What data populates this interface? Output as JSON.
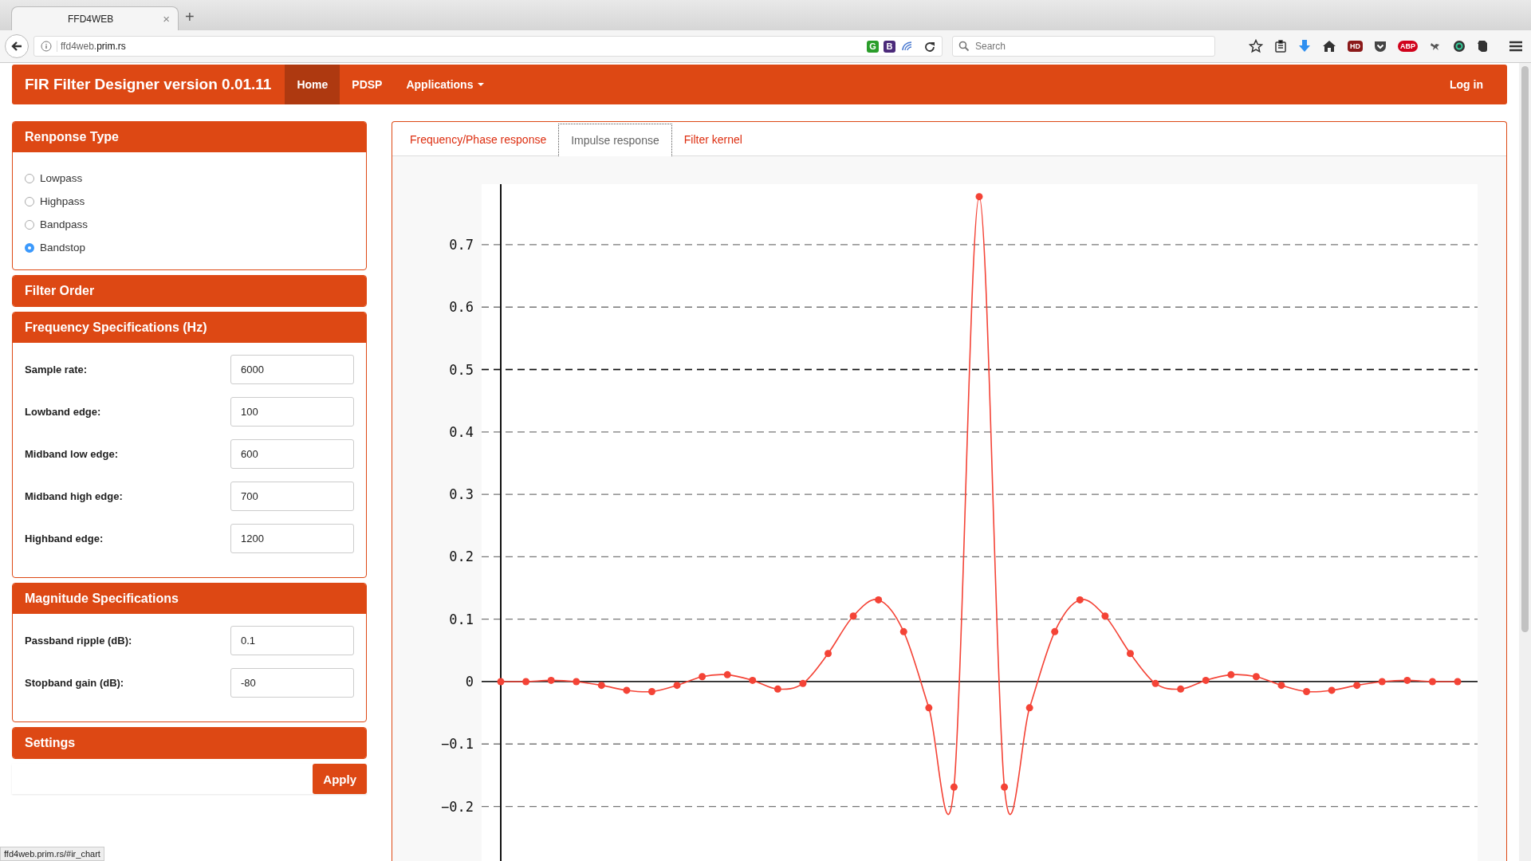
{
  "browser": {
    "tab_title": "FFD4WEB",
    "tab_close": "×",
    "new_tab": "+",
    "address_host": "ffd4web.",
    "address_domain": "prim.rs",
    "url_badges": [
      "G",
      "B"
    ],
    "search_placeholder": "Search",
    "toolbar_badges": [
      "HD",
      "ABP"
    ],
    "status_url": "ffd4web.prim.rs/#ir_chart"
  },
  "navbar": {
    "brand": "FIR Filter Designer version 0.01.11",
    "items": [
      {
        "label": "Home",
        "selected": true,
        "dropdown": false
      },
      {
        "label": "PDSP",
        "selected": false,
        "dropdown": false
      },
      {
        "label": "Applications",
        "selected": false,
        "dropdown": true
      }
    ],
    "login": "Log in"
  },
  "sidebar": {
    "panels": [
      {
        "kind": "radios",
        "title": "Renponse Type",
        "options": [
          {
            "label": "Lowpass",
            "selected": false
          },
          {
            "label": "Highpass",
            "selected": false
          },
          {
            "label": "Bandpass",
            "selected": false
          },
          {
            "label": "Bandstop",
            "selected": true
          }
        ]
      },
      {
        "kind": "header",
        "title": "Filter Order"
      },
      {
        "kind": "fields",
        "title": "Frequency Specifications (Hz)",
        "fields": [
          {
            "label": "Sample rate:",
            "value": "6000"
          },
          {
            "label": "Lowband edge:",
            "value": "100"
          },
          {
            "label": "Midband low edge:",
            "value": "600"
          },
          {
            "label": "Midband high edge:",
            "value": "700"
          },
          {
            "label": "Highband edge:",
            "value": "1200"
          }
        ]
      },
      {
        "kind": "fields",
        "title": "Magnitude Specifications",
        "fields": [
          {
            "label": "Passband ripple (dB):",
            "value": "0.1"
          },
          {
            "label": "Stopband gain (dB):",
            "value": "-80"
          }
        ]
      },
      {
        "kind": "header",
        "title": "Settings"
      }
    ],
    "apply_button": "Apply"
  },
  "main": {
    "tabs": [
      {
        "label": "Frequency/Phase response",
        "selected": false
      },
      {
        "label": "Impulse response",
        "selected": true
      },
      {
        "label": "Filter kernel",
        "selected": false
      }
    ],
    "chart_data": {
      "type": "line",
      "ylim": [
        -0.29,
        0.797
      ],
      "yticks": [
        {
          "value": -0.2,
          "label": "−0.2"
        },
        {
          "value": -0.1,
          "label": "−0.1"
        },
        0,
        0.1,
        0.2,
        0.3,
        0.4,
        0.5,
        0.6,
        0.7
      ],
      "series": [
        {
          "color": "#f44336",
          "marker": "circle",
          "values": [
            0,
            0,
            0.002,
            0,
            -0.006,
            -0.014,
            -0.016,
            -0.006,
            0.008,
            0.011,
            0.002,
            -0.012,
            -0.003,
            0.045,
            0.105,
            0.131,
            0.08,
            -0.042,
            -0.169,
            0.777,
            -0.169,
            -0.042,
            0.08,
            0.131,
            0.105,
            0.045,
            -0.003,
            -0.012,
            0.002,
            0.011,
            0.008,
            -0.006,
            -0.016,
            -0.014,
            -0.006,
            0,
            0.002,
            0,
            0
          ]
        }
      ],
      "grid": true,
      "ref_lines": [
        {
          "axis": "y",
          "value": 0.5
        }
      ]
    }
  }
}
